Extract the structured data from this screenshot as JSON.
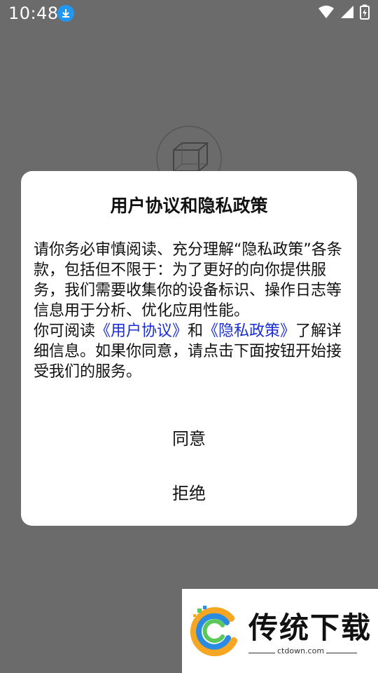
{
  "status_bar": {
    "time": "10:48",
    "icons": [
      "download-icon",
      "wifi-icon",
      "signal-icon",
      "battery-charging-icon"
    ]
  },
  "dialog": {
    "title": "用户协议和隐私政策",
    "para1": "请你务必审慎阅读、充分理解“隐私政策”各条款，包括但不限于：为了更好的向你提供服务，我们需要收集你的设备标识、操作日志等信息用于分析、优化应用性能。",
    "para2_prefix": "你可阅读",
    "link_user_agreement": "《用户协议》",
    "para2_and": "和",
    "link_privacy_policy": "《隐私政策》",
    "para2_suffix": "了解详细信息。如果你同意，请点击下面按钮开始接受我们的服务。",
    "agree_label": "同意",
    "refuse_label": "拒绝"
  },
  "watermark": {
    "brand": "传统下载",
    "url": "ctdown.com"
  },
  "colors": {
    "overlay": "#6b6b6b",
    "link": "#1a2dd6",
    "download_badge": "#2196f3"
  }
}
